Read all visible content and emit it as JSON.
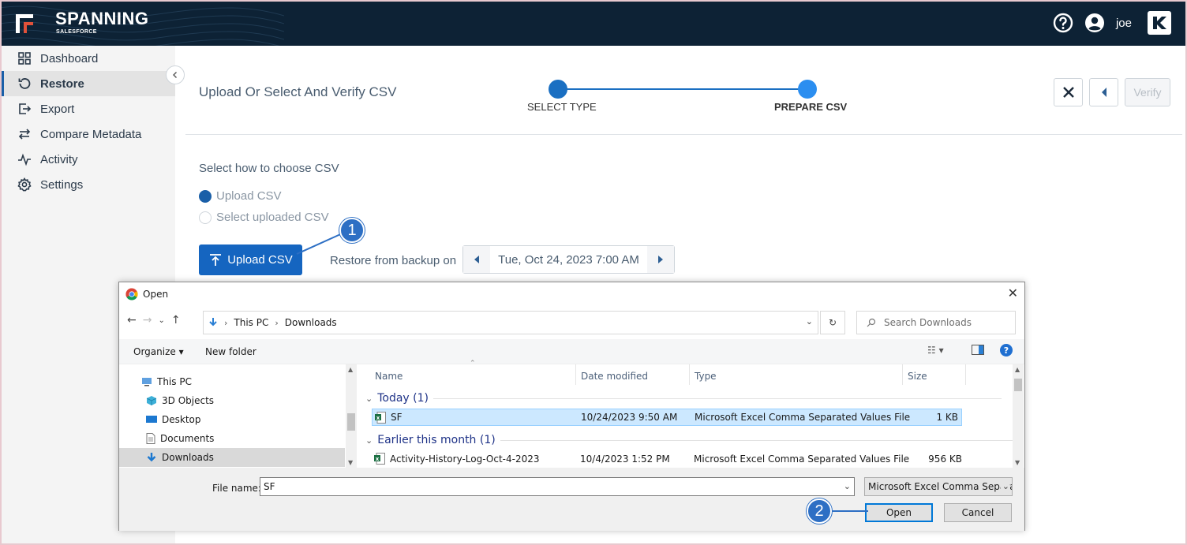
{
  "app": {
    "brand": "SPANNING",
    "brand_sub": "SALESFORCE",
    "user": "joe"
  },
  "sidebar": {
    "items": [
      {
        "label": "Dashboard",
        "icon": "grid-icon"
      },
      {
        "label": "Restore",
        "icon": "restore-icon",
        "active": true
      },
      {
        "label": "Export",
        "icon": "export-icon"
      },
      {
        "label": "Compare Metadata",
        "icon": "compare-icon"
      },
      {
        "label": "Activity",
        "icon": "activity-icon"
      },
      {
        "label": "Settings",
        "icon": "gear-icon"
      }
    ]
  },
  "header": {
    "title": "Upload Or Select And Verify CSV",
    "steps": [
      "SELECT TYPE",
      "PREPARE CSV"
    ],
    "verify_label": "Verify"
  },
  "csv_section": {
    "title": "Select how to choose CSV",
    "options": [
      "Upload CSV",
      "Select uploaded CSV"
    ],
    "selected": "Upload CSV",
    "upload_button": "Upload CSV",
    "restore_label": "Restore from backup on",
    "backup_date": "Tue, Oct 24, 2023 7:00 AM"
  },
  "callouts": [
    "1",
    "2"
  ],
  "dialog": {
    "title": "Open",
    "breadcrumb": [
      "This PC",
      "Downloads"
    ],
    "search_placeholder": "Search Downloads",
    "organize": "Organize",
    "new_folder": "New folder",
    "tree": [
      "This PC",
      "3D Objects",
      "Desktop",
      "Documents",
      "Downloads"
    ],
    "tree_selected": "Downloads",
    "columns": [
      "Name",
      "Date modified",
      "Type",
      "Size"
    ],
    "groups": [
      {
        "label": "Today (1)",
        "files": [
          {
            "name": "SF",
            "date": "10/24/2023 9:50 AM",
            "type": "Microsoft Excel Comma Separated Values File",
            "size": "1 KB",
            "selected": true
          }
        ]
      },
      {
        "label": "Earlier this month (1)",
        "files": [
          {
            "name": "Activity-History-Log-Oct-4-2023",
            "date": "10/4/2023 1:52 PM",
            "type": "Microsoft Excel Comma Separated Values File",
            "size": "956 KB"
          }
        ]
      }
    ],
    "file_name_label": "File name:",
    "file_name_value": "SF",
    "file_type": "Microsoft Excel Comma Separa",
    "open_label": "Open",
    "cancel_label": "Cancel"
  },
  "colors": {
    "topbar": "#0d2235",
    "accent": "#1565c0",
    "step_dot": "#1a6fc2",
    "callout": "#2d6fc4"
  }
}
